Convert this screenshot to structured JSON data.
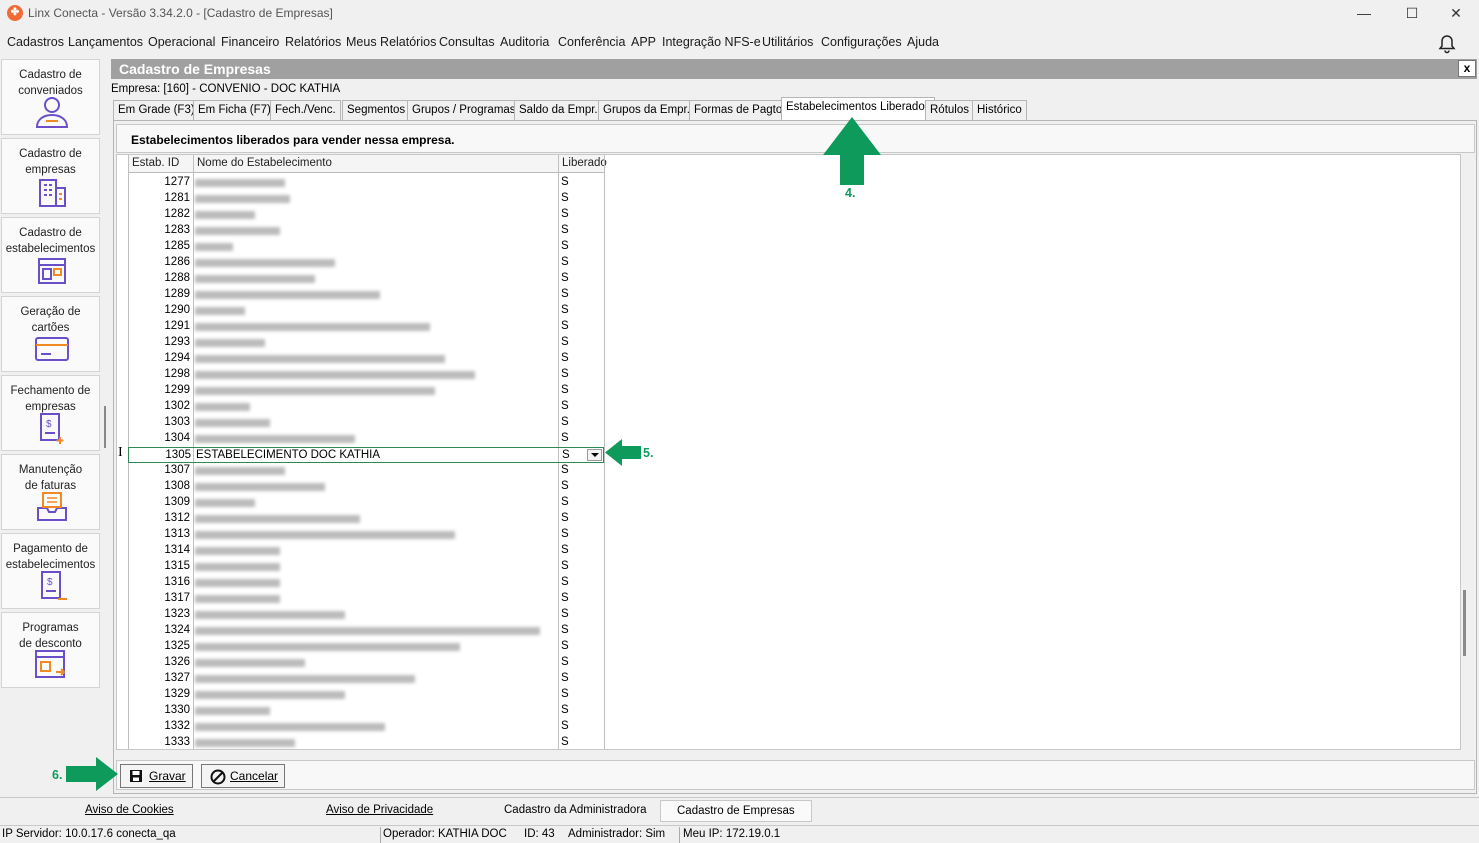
{
  "window": {
    "title": "Linx Conecta - Versão 3.34.2.0 - [Cadastro de Empresas]",
    "minimize": "—",
    "maximize": "☐",
    "close": "✕"
  },
  "menu": [
    "Cadastros",
    "Lançamentos",
    "Operacional",
    "Financeiro",
    "Relatórios",
    "Meus Relatórios",
    "Consultas",
    "Auditoria",
    "Conferência",
    "APP",
    "Integração NFS-e",
    "Utilitários",
    "Configurações",
    "Ajuda"
  ],
  "sidebar": [
    {
      "label": "Cadastro de\nconveniados",
      "icon": "user-icon"
    },
    {
      "label": "Cadastro de\nempresas",
      "icon": "building-icon"
    },
    {
      "label": "Cadastro de\nestabelecimentos",
      "icon": "store-icon"
    },
    {
      "label": "Geração de\ncartões",
      "icon": "card-icon"
    },
    {
      "label": "Fechamento de\nempresas",
      "icon": "invoice-icon"
    },
    {
      "label": "Manutenção\nde faturas",
      "icon": "tray-icon"
    },
    {
      "label": "Pagamento de\nestabelecimentos",
      "icon": "payment-icon"
    },
    {
      "label": "Programas\nde desconto",
      "icon": "discount-icon"
    }
  ],
  "panel": {
    "title": "Cadastro de Empresas",
    "close": "x",
    "empresa": "Empresa: [160] - CONVENIO -  DOC KATHIA"
  },
  "tabs": [
    "Em Grade (F3)",
    "Em Ficha (F7)",
    "Fech./Venc.",
    "Segmentos",
    "Grupos / Programas",
    "Saldo da Empr.",
    "Grupos da Empr.",
    "Formas de Pagto",
    "Estabelecimentos Liberados",
    "Rótulos",
    "Histórico"
  ],
  "active_tab": "Estabelecimentos Liberados",
  "content": {
    "subtitle": "Estabelecimentos liberados para vender nessa empresa.",
    "columns": [
      "Estab. ID",
      "Nome do Estabelecimento",
      "Liberado"
    ],
    "rows": [
      {
        "id": "1277",
        "name": "",
        "liberado": "S"
      },
      {
        "id": "1281",
        "name": "",
        "liberado": "S"
      },
      {
        "id": "1282",
        "name": "",
        "liberado": "S"
      },
      {
        "id": "1283",
        "name": "",
        "liberado": "S"
      },
      {
        "id": "1285",
        "name": "",
        "liberado": "S"
      },
      {
        "id": "1286",
        "name": "",
        "liberado": "S"
      },
      {
        "id": "1288",
        "name": "",
        "liberado": "S"
      },
      {
        "id": "1289",
        "name": "",
        "liberado": "S"
      },
      {
        "id": "1290",
        "name": "",
        "liberado": "S"
      },
      {
        "id": "1291",
        "name": "",
        "liberado": "S"
      },
      {
        "id": "1293",
        "name": "",
        "liberado": "S"
      },
      {
        "id": "1294",
        "name": "",
        "liberado": "S"
      },
      {
        "id": "1298",
        "name": "",
        "liberado": "S"
      },
      {
        "id": "1299",
        "name": "",
        "liberado": "S"
      },
      {
        "id": "1302",
        "name": "",
        "liberado": "S"
      },
      {
        "id": "1303",
        "name": "",
        "liberado": "S"
      },
      {
        "id": "1304",
        "name": "",
        "liberado": "S"
      },
      {
        "id": "1305",
        "name": "ESTABELECIMENTO DOC KATHIA",
        "liberado": "S"
      },
      {
        "id": "1307",
        "name": "",
        "liberado": "S"
      },
      {
        "id": "1308",
        "name": "",
        "liberado": "S"
      },
      {
        "id": "1309",
        "name": "",
        "liberado": "S"
      },
      {
        "id": "1312",
        "name": "",
        "liberado": "S"
      },
      {
        "id": "1313",
        "name": "",
        "liberado": "S"
      },
      {
        "id": "1314",
        "name": "",
        "liberado": "S"
      },
      {
        "id": "1315",
        "name": "",
        "liberado": "S"
      },
      {
        "id": "1316",
        "name": "",
        "liberado": "S"
      },
      {
        "id": "1317",
        "name": "",
        "liberado": "S"
      },
      {
        "id": "1323",
        "name": "",
        "liberado": "S"
      },
      {
        "id": "1324",
        "name": "",
        "liberado": "S"
      },
      {
        "id": "1325",
        "name": "",
        "liberado": "S"
      },
      {
        "id": "1326",
        "name": "",
        "liberado": "S"
      },
      {
        "id": "1327",
        "name": "",
        "liberado": "S"
      },
      {
        "id": "1329",
        "name": "",
        "liberado": "S"
      },
      {
        "id": "1330",
        "name": "",
        "liberado": "S"
      },
      {
        "id": "1332",
        "name": "",
        "liberado": "S"
      },
      {
        "id": "1333",
        "name": "",
        "liberado": "S"
      }
    ],
    "selected_row_id": "1305",
    "blurred_names": true
  },
  "buttons": {
    "save": "Gravar",
    "cancel": "Cancelar"
  },
  "annotations": {
    "step4": "4.",
    "step5": "5.",
    "step6": "6."
  },
  "bottom_tabs": [
    "Aviso de Cookies",
    "Aviso de Privacidade",
    "Cadastro da Administradora",
    "Cadastro de Empresas"
  ],
  "status": {
    "server": "IP Servidor: 10.0.17.6 conecta_qa",
    "operator": "Operador: KATHIA DOC",
    "id": "ID: 43",
    "admin": "Administrador: Sim",
    "ip": "Meu IP: 172.19.0.1"
  },
  "colors": {
    "accent_green": "#0e9a5b",
    "panel_header": "#a0a0a0",
    "icon_purple": "#6a4fc8",
    "icon_orange": "#f08a24"
  }
}
